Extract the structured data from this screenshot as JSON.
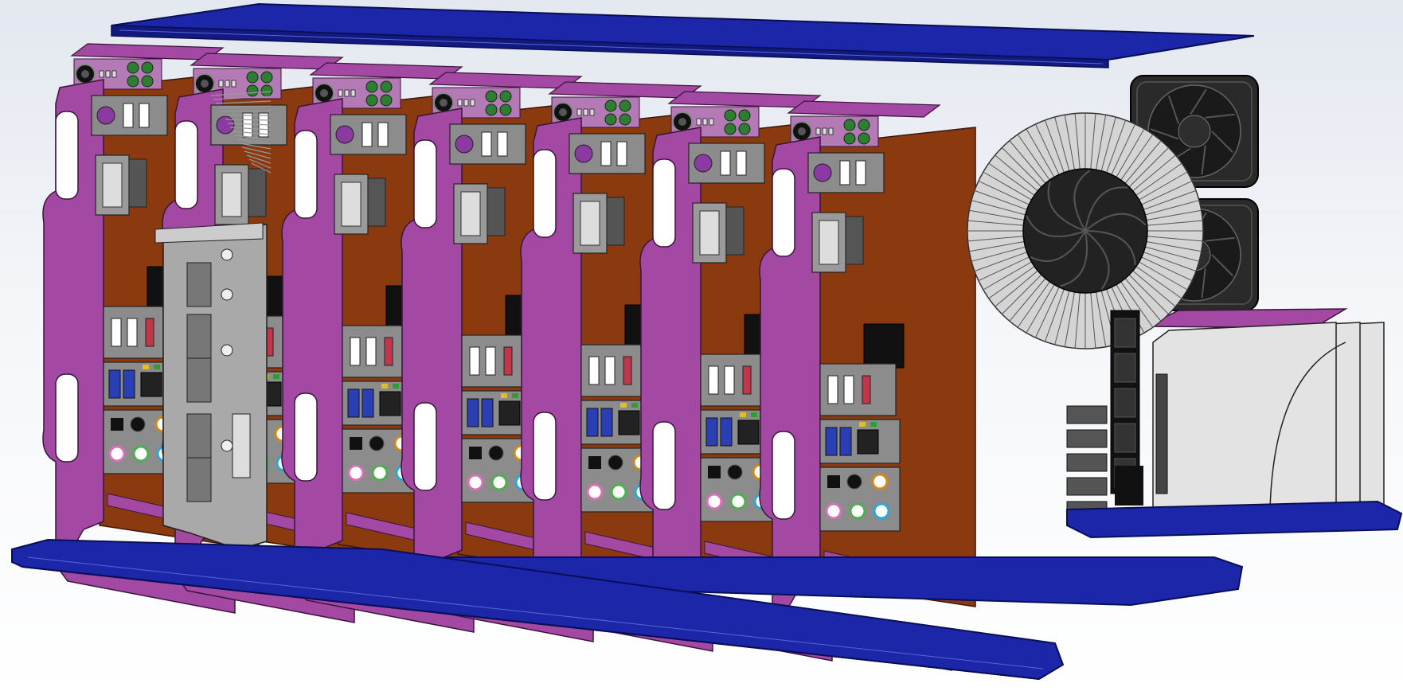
{
  "scene": {
    "kind": "3d-cad-assembly-render",
    "colors": {
      "rails": "#1b26a8",
      "rail_edge": "#0a0f55",
      "brackets": "#a349a4",
      "bracket_edge": "#3a143a",
      "board": "#8b3a10",
      "connectors": "#8c8c8c",
      "ports_usb": "#2b3fb5",
      "leds": "#2f7d32",
      "heatsink": "#c8c8c8",
      "fans": "#2a2a2a",
      "drives": "#e3e3e3"
    },
    "modules": {
      "count": 7
    },
    "fans": {
      "count": 2
    },
    "drives": {
      "count": 3
    }
  }
}
